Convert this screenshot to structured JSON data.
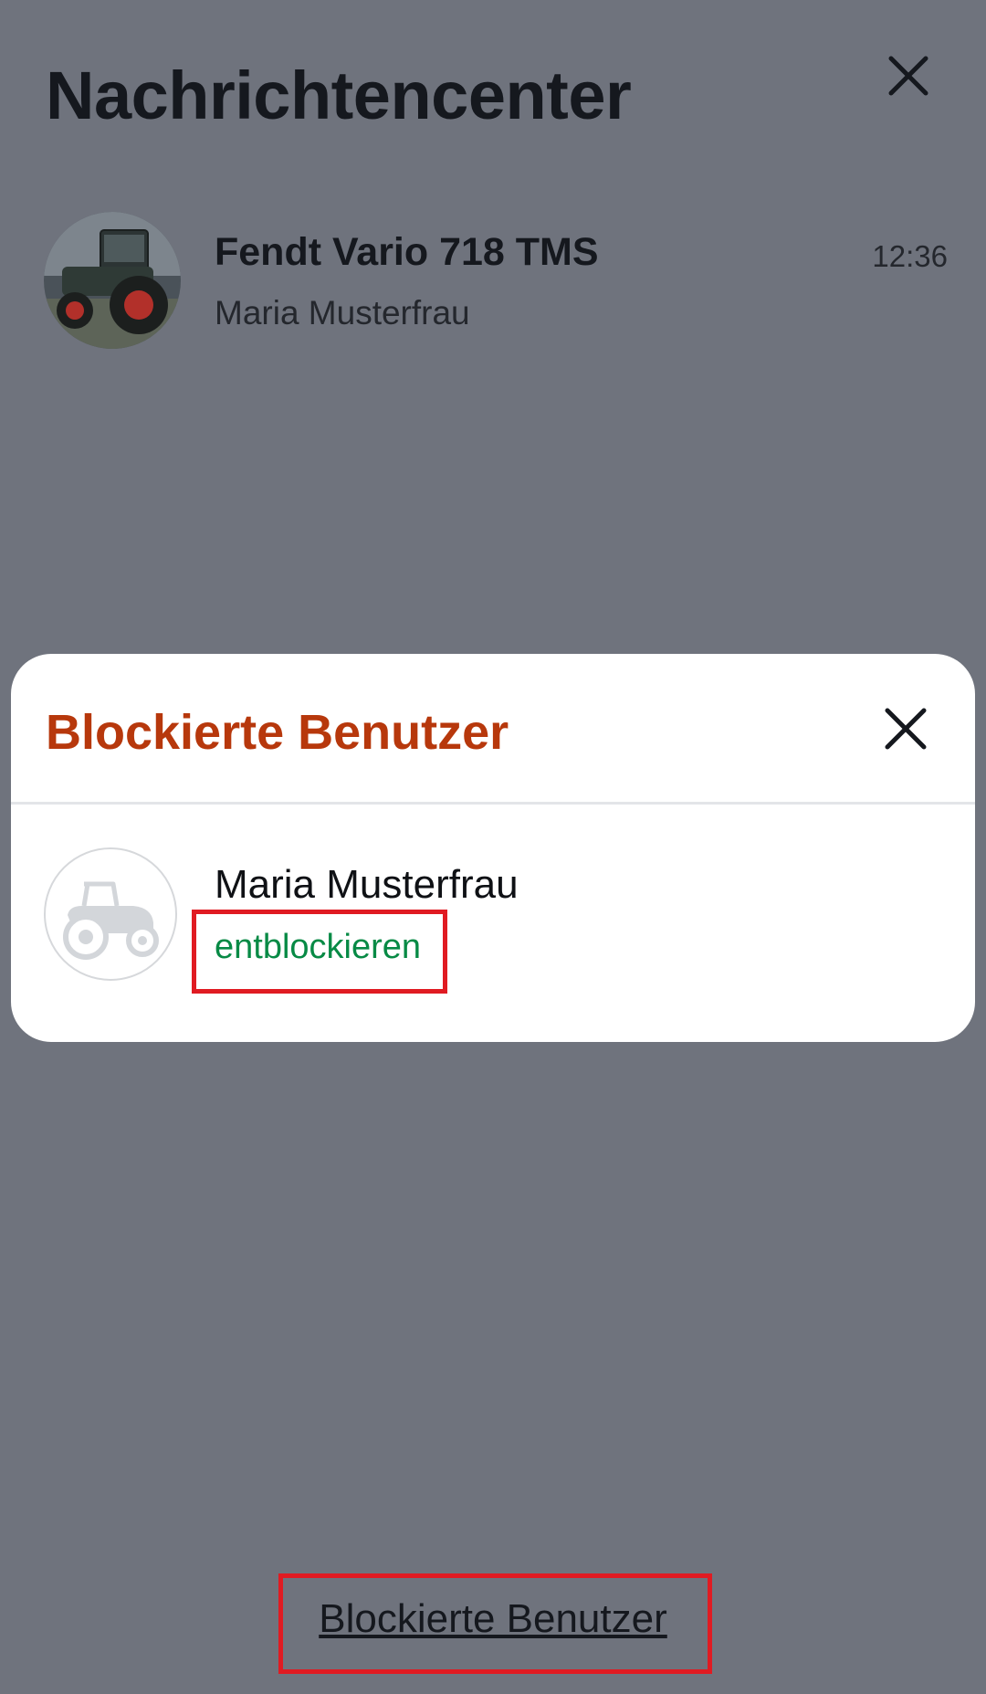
{
  "header": {
    "title": "Nachrichtencenter",
    "close_icon": "close-icon"
  },
  "conversation": {
    "title": "Fendt Vario 718 TMS",
    "subtitle": "Maria Musterfrau",
    "time": "12:36",
    "avatar": "tractor-photo"
  },
  "modal": {
    "title": "Blockierte Benutzer",
    "close_icon": "close-icon",
    "blocked_users": [
      {
        "name": "Maria Musterfrau",
        "action_label": "entblockieren",
        "avatar_icon": "tractor-icon"
      }
    ]
  },
  "footer": {
    "link_label": "Blockierte Benutzer"
  },
  "colors": {
    "overlay": "#6f737d",
    "modal_title": "#b7380c",
    "action": "#078a45",
    "highlight": "#e01b22"
  }
}
